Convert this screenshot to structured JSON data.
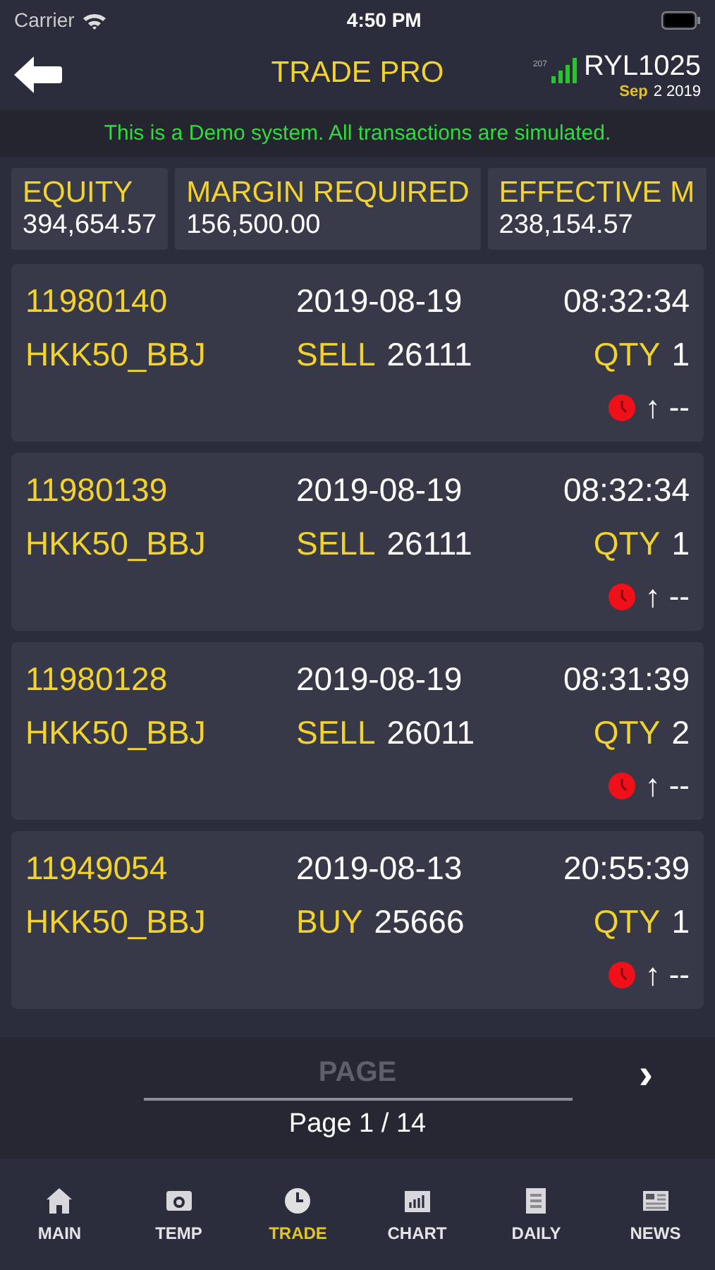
{
  "status_bar": {
    "carrier": "Carrier",
    "time": "4:50 PM"
  },
  "header": {
    "title": "TRADE PRO",
    "ping": "207",
    "account": "RYL1025",
    "date_month": "Sep",
    "date_rest": "2 2019"
  },
  "banner": "This is a Demo system. All transactions are simulated.",
  "summary": [
    {
      "label": "EQUITY",
      "value": "394,654.57"
    },
    {
      "label": "MARGIN REQUIRED",
      "value": "156,500.00"
    },
    {
      "label": "EFFECTIVE M",
      "value": "238,154.57"
    }
  ],
  "orders": [
    {
      "id": "11980140",
      "date": "2019-08-19",
      "time": "08:32:34",
      "symbol": "HKK50_BBJ",
      "side": "SELL",
      "price": "26111",
      "qty_label": "QTY",
      "qty": "1",
      "arrow": "↑",
      "pl": "--"
    },
    {
      "id": "11980139",
      "date": "2019-08-19",
      "time": "08:32:34",
      "symbol": "HKK50_BBJ",
      "side": "SELL",
      "price": "26111",
      "qty_label": "QTY",
      "qty": "1",
      "arrow": "↑",
      "pl": "--"
    },
    {
      "id": "11980128",
      "date": "2019-08-19",
      "time": "08:31:39",
      "symbol": "HKK50_BBJ",
      "side": "SELL",
      "price": "26011",
      "qty_label": "QTY",
      "qty": "2",
      "arrow": "↑",
      "pl": "--"
    },
    {
      "id": "11949054",
      "date": "2019-08-13",
      "time": "20:55:39",
      "symbol": "HKK50_BBJ",
      "side": "BUY",
      "price": "25666",
      "qty_label": "QTY",
      "qty": "1",
      "arrow": "↑",
      "pl": "--"
    }
  ],
  "pager": {
    "title": "PAGE",
    "next": "›",
    "page": "Page 1 / 14"
  },
  "tabs": [
    {
      "label": "MAIN",
      "kind": "home",
      "selected": false
    },
    {
      "label": "TEMP",
      "kind": "money",
      "selected": false
    },
    {
      "label": "TRADE",
      "kind": "clock",
      "selected": true
    },
    {
      "label": "CHART",
      "kind": "chart",
      "selected": false
    },
    {
      "label": "DAILY",
      "kind": "doc",
      "selected": false
    },
    {
      "label": "NEWS",
      "kind": "news",
      "selected": false
    }
  ]
}
